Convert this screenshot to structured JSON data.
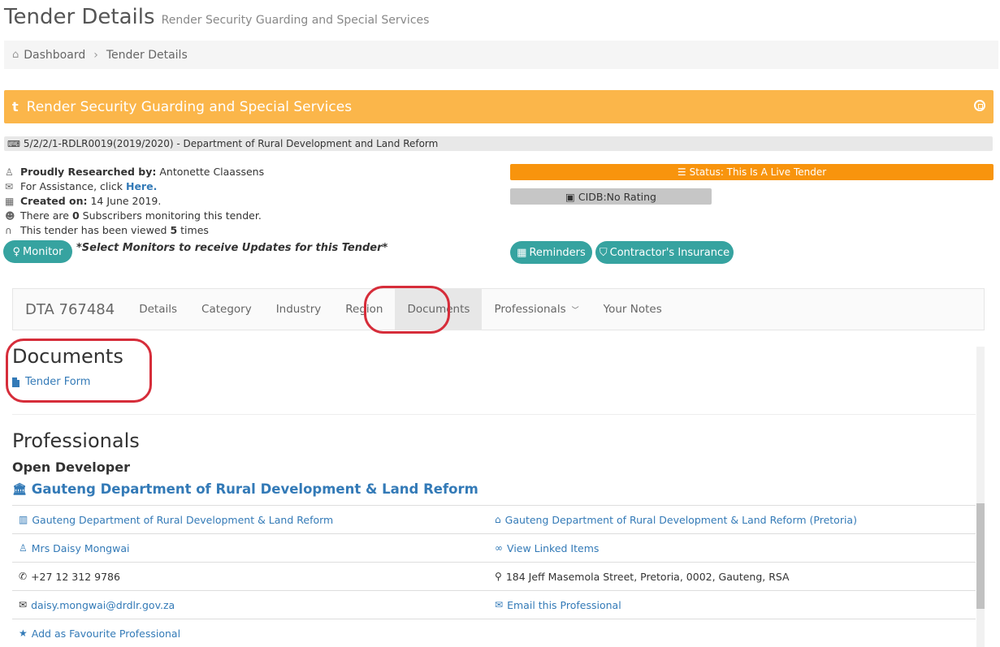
{
  "page": {
    "title": "Tender Details",
    "subtitle": "Render Security Guarding and Special Services"
  },
  "breadcrumb": {
    "items": [
      "Dashboard",
      "Tender Details"
    ],
    "separator": "›"
  },
  "portlet": {
    "icon_letter": "t",
    "title": "Render Security Guarding and Special Services",
    "accent": "#fbb64a"
  },
  "reference": {
    "text": "5/2/2/1-RDLR0019(2019/2020) - Department of Rural Development and Land Reform"
  },
  "info": {
    "researched_label": "Proudly Researched by:",
    "researched_value": "Antonette Claassens",
    "assistance_text": "For Assistance, click",
    "assistance_link": "Here.",
    "created_label": "Created on:",
    "created_value": "14 June 2019.",
    "subscribers_pre": "There are",
    "subscribers_count": "0",
    "subscribers_post": "Subscribers monitoring this tender.",
    "views_pre": "This tender has been viewed",
    "views_count": "5",
    "views_post": "times"
  },
  "monitor": {
    "button_label": "Monitor",
    "note": "*Select Monitors to receive Updates for this Tender*"
  },
  "status": {
    "label": "Status: This Is A Live Tender",
    "color": "#f8940d"
  },
  "cidb": {
    "label": "CIDB:No Rating"
  },
  "actions": {
    "reminders_label": "Reminders",
    "insurance_label": "Contractor's Insurance"
  },
  "tabs": {
    "brand": "DTA 767484",
    "items": [
      "Details",
      "Category",
      "Industry",
      "Region",
      "Documents",
      "Professionals",
      "Your Notes"
    ],
    "active": "Documents"
  },
  "documents": {
    "heading": "Documents",
    "items": [
      "Tender Form"
    ]
  },
  "professionals": {
    "heading": "Professionals",
    "subheading": "Open Developer",
    "org_name": "Gauteng Department of Rural Development & Land Reform",
    "rows": [
      {
        "left": "Gauteng Department of Rural Development & Land Reform",
        "right": "Gauteng Department of Rural Development & Land Reform (Pretoria)"
      },
      {
        "left": "Mrs Daisy Mongwai",
        "right": "View Linked Items"
      },
      {
        "left": "+27 12 312 9786",
        "right": "184 Jeff Masemola Street, Pretoria, 0002, Gauteng, RSA"
      },
      {
        "left": "daisy.mongwai@drdlr.gov.za",
        "right": "Email this Professional"
      },
      {
        "left": "Add as Favourite Professional",
        "right": ""
      }
    ]
  }
}
